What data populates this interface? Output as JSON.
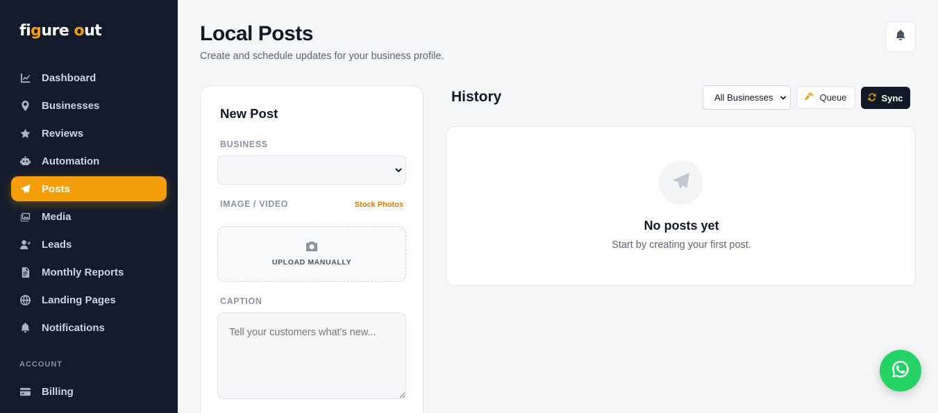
{
  "brand": {
    "logo_prefix": "fi",
    "logo_g": "g",
    "logo_mid": "ure ",
    "logo_o": "o",
    "logo_suffix": "ut"
  },
  "sidebar": {
    "items": [
      {
        "label": "Dashboard",
        "icon": "chart-line-icon"
      },
      {
        "label": "Businesses",
        "icon": "map-pin-icon"
      },
      {
        "label": "Reviews",
        "icon": "star-icon"
      },
      {
        "label": "Automation",
        "icon": "robot-icon"
      },
      {
        "label": "Posts",
        "icon": "paper-plane-icon",
        "active": true
      },
      {
        "label": "Media",
        "icon": "images-icon"
      },
      {
        "label": "Leads",
        "icon": "user-plus-icon"
      },
      {
        "label": "Monthly Reports",
        "icon": "file-icon"
      },
      {
        "label": "Landing Pages",
        "icon": "globe-icon"
      },
      {
        "label": "Notifications",
        "icon": "bell-icon"
      }
    ],
    "account_label": "ACCOUNT",
    "billing": {
      "label": "Billing",
      "icon": "credit-card-icon"
    }
  },
  "header": {
    "title": "Local Posts",
    "subtitle": "Create and schedule updates for your business profile."
  },
  "new_post": {
    "title": "New Post",
    "business_label": "BUSINESS",
    "business_value": "",
    "media_label": "IMAGE / VIDEO",
    "stock_photos_label": "Stock Photos",
    "upload_label": "UPLOAD MANUALLY",
    "caption_label": "CAPTION",
    "caption_placeholder": "Tell your customers what's new..."
  },
  "history": {
    "title": "History",
    "filter_value": "All Businesses",
    "queue_label": "Queue",
    "sync_label": "Sync",
    "empty_title": "No posts yet",
    "empty_subtitle": "Start by creating your first post."
  },
  "colors": {
    "sidebar_bg": "#121a2b",
    "accent": "#f59e0b",
    "whatsapp": "#25d366",
    "dark_button": "#111827"
  }
}
